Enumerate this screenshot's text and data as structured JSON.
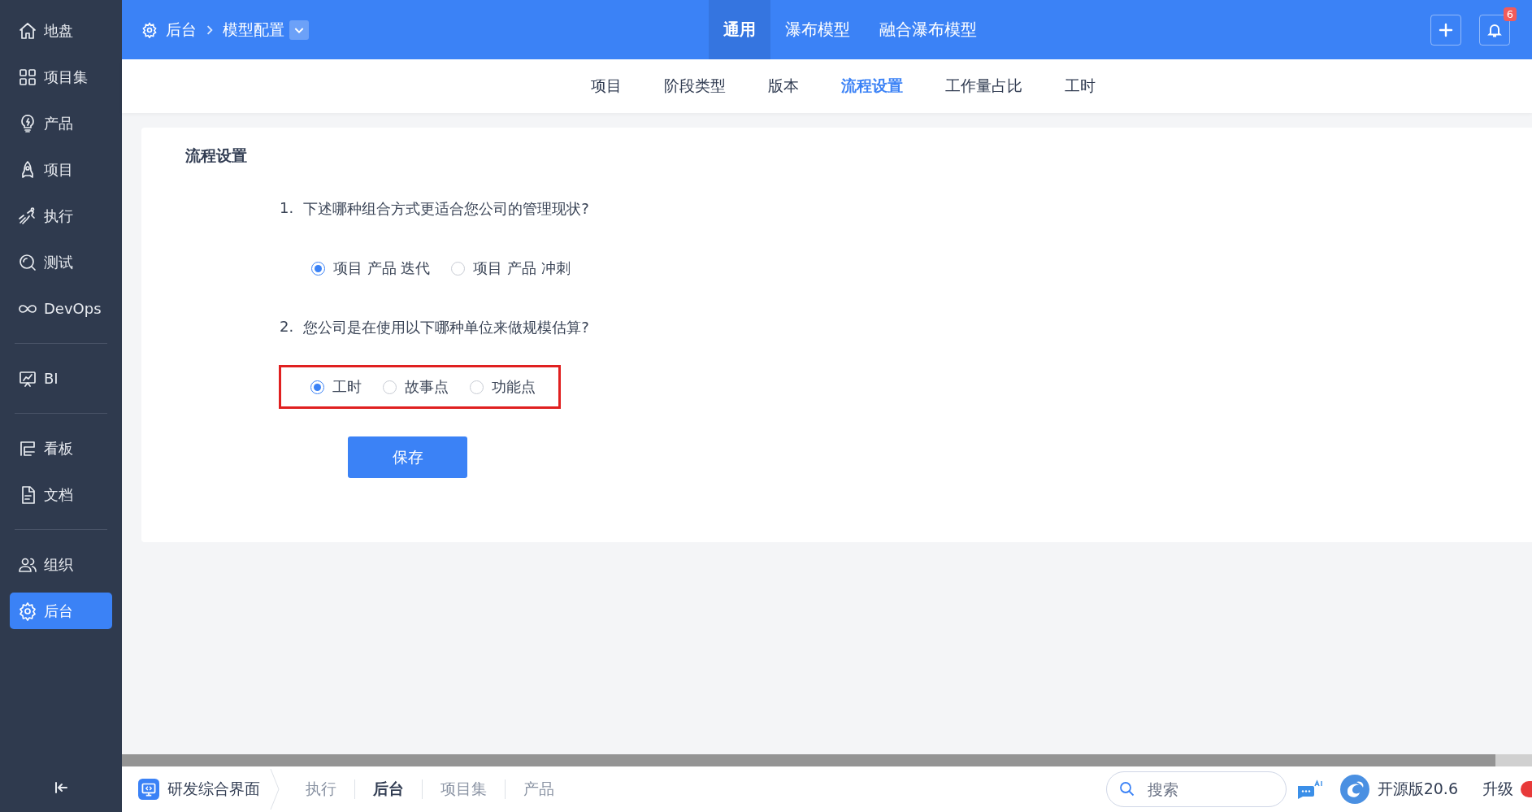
{
  "sidebar": {
    "items": [
      {
        "kind": "item",
        "label": "地盘",
        "selected": false
      },
      {
        "kind": "item",
        "label": "项目集",
        "selected": false
      },
      {
        "kind": "item",
        "label": "产品",
        "selected": false
      },
      {
        "kind": "item",
        "label": "项目",
        "selected": false
      },
      {
        "kind": "item",
        "label": "执行",
        "selected": false
      },
      {
        "kind": "item",
        "label": "测试",
        "selected": false
      },
      {
        "kind": "item",
        "label": "DevOps",
        "selected": false
      },
      {
        "kind": "divider"
      },
      {
        "kind": "item",
        "label": "BI",
        "selected": false
      },
      {
        "kind": "divider"
      },
      {
        "kind": "item",
        "label": "看板",
        "selected": false
      },
      {
        "kind": "item",
        "label": "文档",
        "selected": false
      },
      {
        "kind": "divider"
      },
      {
        "kind": "item",
        "label": "组织",
        "selected": false
      },
      {
        "kind": "item",
        "label": "后台",
        "selected": true
      }
    ]
  },
  "header": {
    "breadcrumb": [
      "后台",
      "模型配置"
    ],
    "tabs": [
      {
        "label": "通用",
        "selected": true
      },
      {
        "label": "瀑布模型",
        "selected": false
      },
      {
        "label": "融合瀑布模型",
        "selected": false
      }
    ],
    "notification_count": "6"
  },
  "subnav": [
    {
      "label": "项目",
      "selected": false
    },
    {
      "label": "阶段类型",
      "selected": false
    },
    {
      "label": "版本",
      "selected": false
    },
    {
      "label": "流程设置",
      "selected": true
    },
    {
      "label": "工作量占比",
      "selected": false
    },
    {
      "label": "工时",
      "selected": false
    }
  ],
  "form": {
    "title": "流程设置",
    "questions": [
      {
        "number": "1.",
        "text": "下述哪种组合方式更适合您公司的管理现状?",
        "highlighted": false,
        "options": [
          {
            "label": "项目 产品 迭代",
            "selected": true
          },
          {
            "label": "项目 产品 冲刺",
            "selected": false
          }
        ]
      },
      {
        "number": "2.",
        "text": "您公司是在使用以下哪种单位来做规模估算?",
        "highlighted": true,
        "options": [
          {
            "label": "工时",
            "selected": true
          },
          {
            "label": "故事点",
            "selected": false
          },
          {
            "label": "功能点",
            "selected": false
          }
        ]
      }
    ],
    "save_button": "保存"
  },
  "taskbar": {
    "app": "研发综合界面",
    "tabs": [
      {
        "label": "执行",
        "selected": false
      },
      {
        "label": "后台",
        "selected": true
      },
      {
        "label": "项目集",
        "selected": false
      },
      {
        "label": "产品",
        "selected": false
      }
    ],
    "search": {
      "placeholder": "搜索"
    },
    "version": "开源版20.6",
    "upgrade": "升级"
  }
}
